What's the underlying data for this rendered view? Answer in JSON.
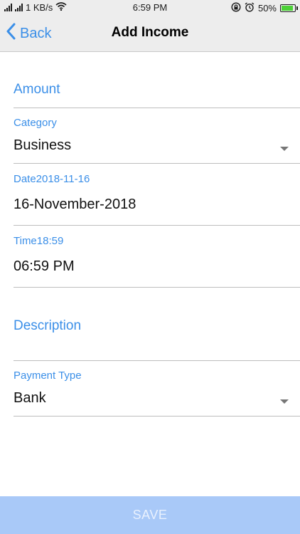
{
  "status_bar": {
    "network_speed": "1 KB/s",
    "time": "6:59 PM",
    "battery_percent": "50%",
    "battery_level": 0.5,
    "battery_color": "#4cd137"
  },
  "nav": {
    "back_label": "Back",
    "title": "Add Income"
  },
  "form": {
    "amount": {
      "placeholder": "Amount",
      "value": ""
    },
    "category": {
      "label": "Category",
      "value": "Business"
    },
    "date": {
      "label": "Date2018-11-16",
      "value": "16-November-2018"
    },
    "time": {
      "label": "Time18:59",
      "value": "06:59 PM"
    },
    "description": {
      "placeholder": "Description",
      "value": ""
    },
    "payment_type": {
      "label": "Payment Type",
      "value": "Bank"
    }
  },
  "save_label": "SAVE",
  "colors": {
    "accent": "#3b8fe8",
    "save_button_bg": "#a9c9f8",
    "save_button_text": "#e9f1fe",
    "header_bg": "#ededed"
  },
  "icons": {
    "back": "chevron-left-icon",
    "dropdown": "caret-down-icon",
    "wifi": "wifi-icon",
    "battery": "battery-charging-icon",
    "alarm": "alarm-icon",
    "rotation_lock": "rotation-lock-icon"
  }
}
